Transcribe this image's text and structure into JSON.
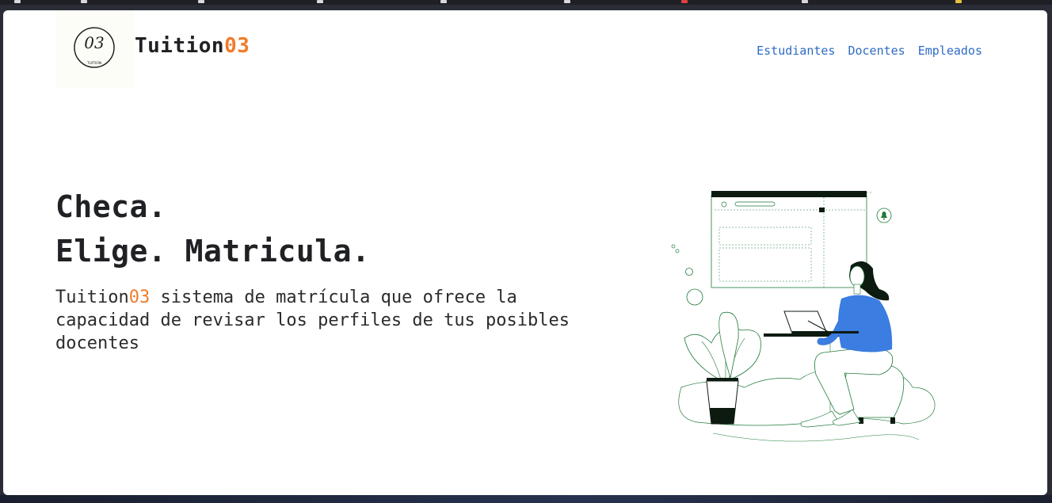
{
  "header": {
    "brand_prefix": "Tuition",
    "brand_suffix": "03",
    "logo_mark": "03",
    "logo_subtext": "TUITION"
  },
  "nav": {
    "items": [
      {
        "label": "Estudiantes"
      },
      {
        "label": "Docentes"
      },
      {
        "label": "Empleados"
      }
    ]
  },
  "hero": {
    "line1": "Checa.",
    "line2": "Elige. Matricula.",
    "desc_prefix": "Tuition",
    "desc_accent": "03",
    "desc_rest": " sistema de matrícula que ofrece la capacidad de revisar los perfiles de tus posibles docentes"
  },
  "colors": {
    "accent": "#f07c2a",
    "link": "#2f6bc4",
    "illustration_blue": "#3b7de0",
    "illustration_green": "#1f7a3a"
  },
  "icons": {
    "illustration": "woman-with-laptop-illustration",
    "bell": "bell-icon"
  }
}
